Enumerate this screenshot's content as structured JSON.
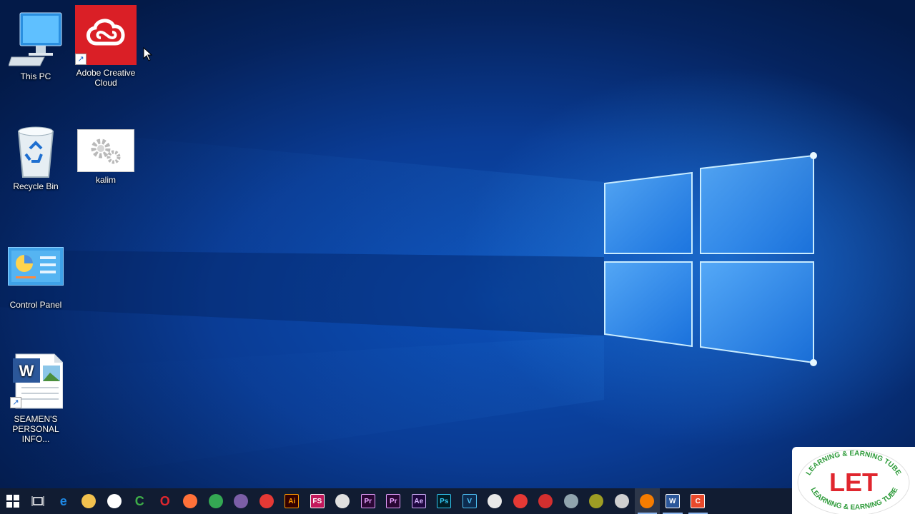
{
  "desktop": {
    "icons": [
      {
        "label": "This PC",
        "icon": "computer-icon"
      },
      {
        "label": "Adobe Creative Cloud",
        "icon": "adobe-creative-cloud-icon"
      },
      {
        "label": "Recycle Bin",
        "icon": "recycle-bin-icon"
      },
      {
        "label": "kalim",
        "icon": "settings-file-icon"
      },
      {
        "label": "Control Panel",
        "icon": "control-panel-icon"
      },
      {
        "label": "SEAMEN'S PERSONAL INFO...",
        "icon": "word-document-icon"
      }
    ]
  },
  "taskbar": {
    "pinned": [
      {
        "name": "start",
        "icon": "windows-logo-icon"
      },
      {
        "name": "task-view",
        "icon": "task-view-icon"
      },
      {
        "name": "edge",
        "icon": "edge-icon",
        "text": "e",
        "color": "#1e88e5"
      },
      {
        "name": "file-explorer",
        "icon": "folder-icon",
        "color": "#f2c14e"
      },
      {
        "name": "store",
        "icon": "store-icon",
        "color": "#ffffff"
      },
      {
        "name": "camtasia",
        "icon": "camtasia-icon",
        "text": "C",
        "color": "#3fae49"
      },
      {
        "name": "opera",
        "icon": "opera-icon",
        "text": "O",
        "color": "#e0262e"
      },
      {
        "name": "firefox",
        "icon": "firefox-icon",
        "color": "#ff7139"
      },
      {
        "name": "chrome",
        "icon": "chrome-icon",
        "color": "#34a853"
      },
      {
        "name": "video-editor",
        "icon": "clapper-icon",
        "color": "#7b5ea7"
      },
      {
        "name": "downloader",
        "icon": "download-icon",
        "color": "#e53935"
      },
      {
        "name": "illustrator",
        "icon": "illustrator-icon",
        "text": "Ai",
        "color": "#ff9a00",
        "bg": "#330000"
      },
      {
        "name": "fs",
        "icon": "fs-icon",
        "text": "FS",
        "color": "#ffffff",
        "bg": "#c2185b"
      },
      {
        "name": "paint-tool",
        "icon": "palette-icon",
        "color": "#e0e0e0"
      },
      {
        "name": "premiere-1",
        "icon": "premiere-icon",
        "text": "Pr",
        "color": "#e6a2ff",
        "bg": "#2a0634"
      },
      {
        "name": "premiere-2",
        "icon": "premiere-icon",
        "text": "Pr",
        "color": "#e6a2ff",
        "bg": "#2a0634"
      },
      {
        "name": "after-effects",
        "icon": "after-effects-icon",
        "text": "Ae",
        "color": "#d5b5ff",
        "bg": "#1f0740"
      },
      {
        "name": "photoshop",
        "icon": "photoshop-icon",
        "text": "Ps",
        "color": "#31c5f0",
        "bg": "#001d26"
      },
      {
        "name": "v-app",
        "icon": "v-icon",
        "text": "V",
        "color": "#4fc3f7",
        "bg": "#0d2b4e"
      },
      {
        "name": "notepad",
        "icon": "notepad-icon",
        "color": "#e8e8e8"
      },
      {
        "name": "pdf-reader",
        "icon": "pdf-icon",
        "color": "#e53935"
      },
      {
        "name": "cloud-app",
        "icon": "cloud-icon",
        "color": "#d32f2f"
      },
      {
        "name": "window-app",
        "icon": "window-icon",
        "color": "#90a4ae"
      },
      {
        "name": "pen-app",
        "icon": "pen-icon",
        "color": "#9e9d24"
      },
      {
        "name": "obs",
        "icon": "obs-icon",
        "color": "#cfcfcf"
      },
      {
        "name": "media-player",
        "icon": "play-icon",
        "color": "#f57c00"
      },
      {
        "name": "word",
        "icon": "word-icon",
        "text": "W",
        "color": "#ffffff",
        "bg": "#2b579a"
      },
      {
        "name": "camtasia-recorder",
        "icon": "camtasia-recorder-icon",
        "text": "C",
        "color": "#ffffff",
        "bg": "#e8492b"
      }
    ],
    "tray": [
      {
        "name": "people",
        "icon": "people-icon"
      },
      {
        "name": "show-hidden",
        "icon": "chevron-up-icon"
      },
      {
        "name": "recorder-tray",
        "icon": "record-icon"
      }
    ]
  },
  "watermark": {
    "letters": "LET",
    "ring_text": "LEARNING & EARNING TUBE"
  }
}
